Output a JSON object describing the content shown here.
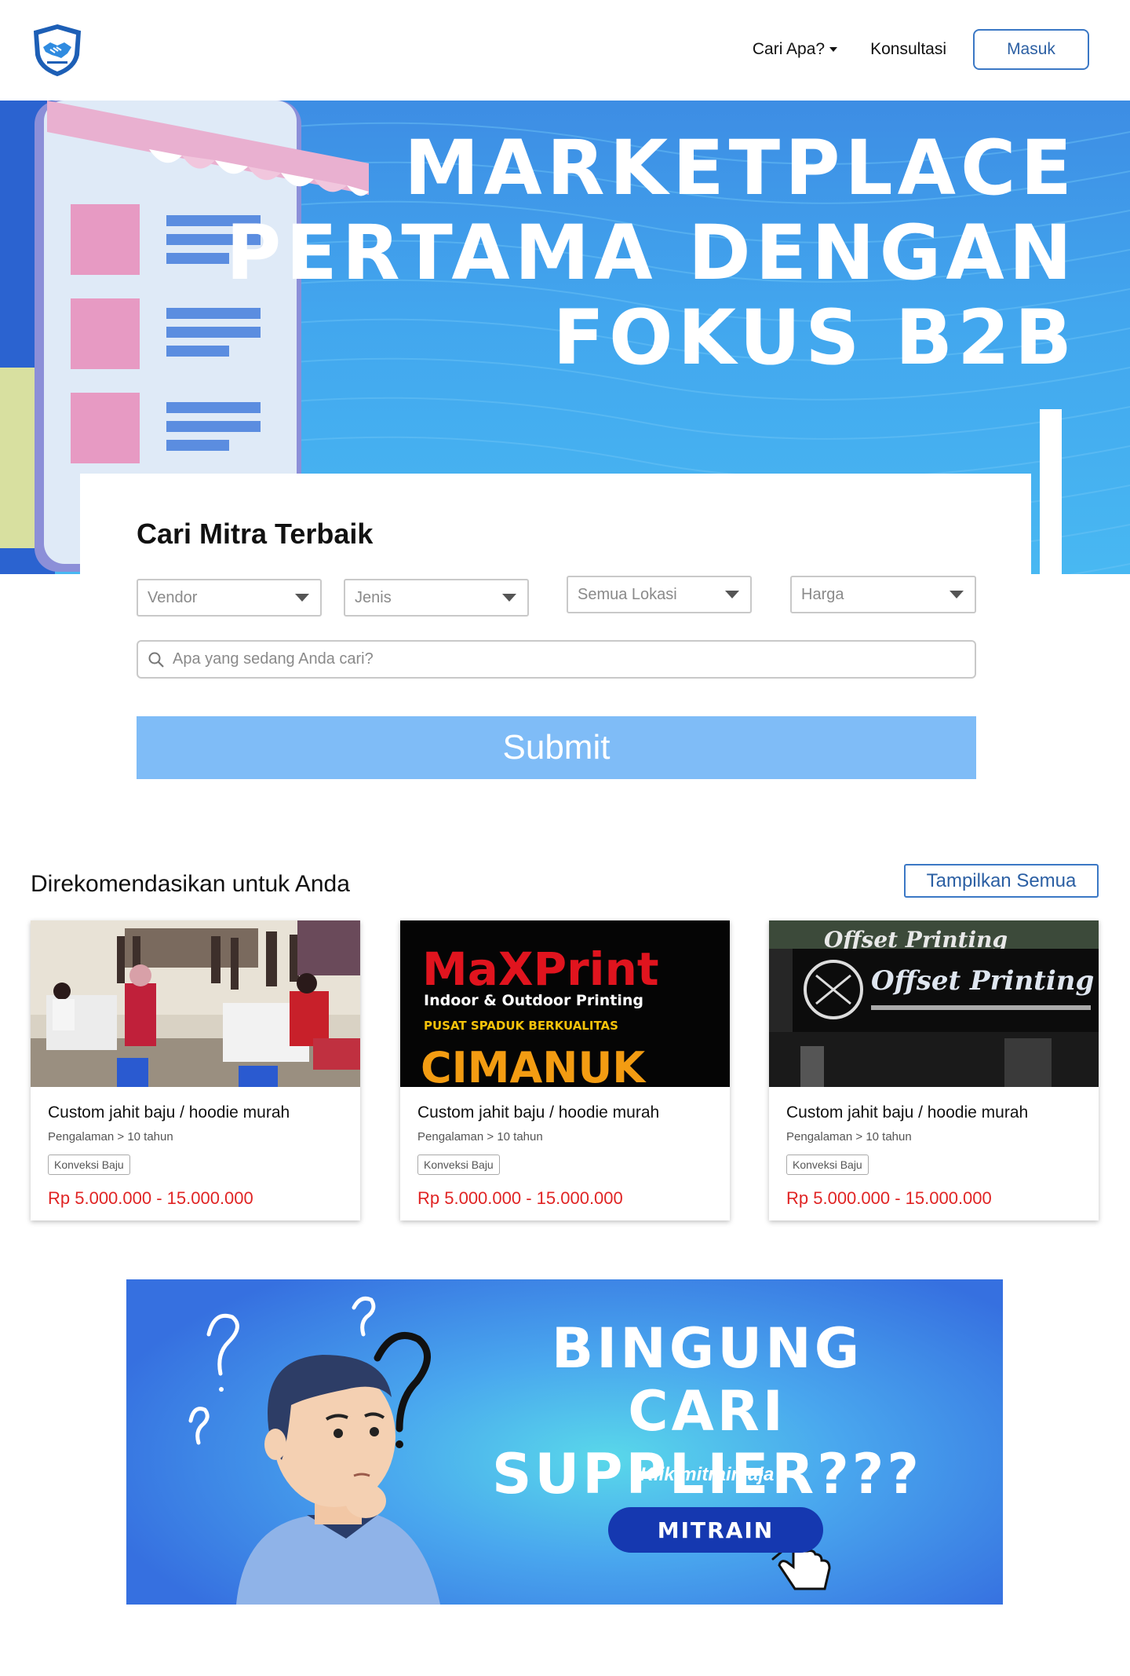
{
  "header": {
    "nav": {
      "cari_apa": "Cari Apa?",
      "konsultasi": "Konsultasi",
      "masuk": "Masuk"
    }
  },
  "hero": {
    "title_lines": [
      "MARKETPLACE",
      "PERTAMA DENGAN",
      "FOKUS B2B"
    ]
  },
  "search": {
    "title": "Cari Mitra Terbaik",
    "vendor": "Vendor",
    "jenis": "Jenis",
    "lokasi": "Semua Lokasi",
    "harga": "Harga",
    "placeholder": "Apa yang sedang Anda cari?",
    "submit": "Submit"
  },
  "recommended": {
    "title": "Direkomendasikan untuk Anda",
    "show_all": "Tampilkan Semua",
    "cards": [
      {
        "name": "Custom jahit baju / hoodie murah",
        "experience": "Pengalaman > 10 tahun",
        "tag": "Konveksi Baju",
        "price": "Rp 5.000.000 - 15.000.000"
      },
      {
        "name": "Custom jahit baju / hoodie murah",
        "experience": "Pengalaman > 10 tahun",
        "tag": "Konveksi Baju",
        "price": "Rp 5.000.000 - 15.000.000",
        "image_text": [
          "MaXPrint",
          "Indoor & Outdoor Printing",
          "PUSAT SPADUK BERKUALITAS",
          "CIMANUK"
        ]
      },
      {
        "name": "Custom jahit baju / hoodie murah",
        "experience": "Pengalaman > 10 tahun",
        "tag": "Konveksi Baju",
        "price": "Rp 5.000.000 - 15.000.000",
        "image_text": [
          "Offset Printing",
          "Offset Printing"
        ]
      }
    ]
  },
  "banner": {
    "title_lines": [
      "BINGUNG CARI",
      "SUPPLIER???"
    ],
    "subtitle": "Klik mitrain aja",
    "button": "MITRAIN"
  },
  "colors": {
    "primary": "#3b78c5",
    "submit": "#7fbcf7",
    "price": "#e02424",
    "banner_button": "#1538b0"
  }
}
